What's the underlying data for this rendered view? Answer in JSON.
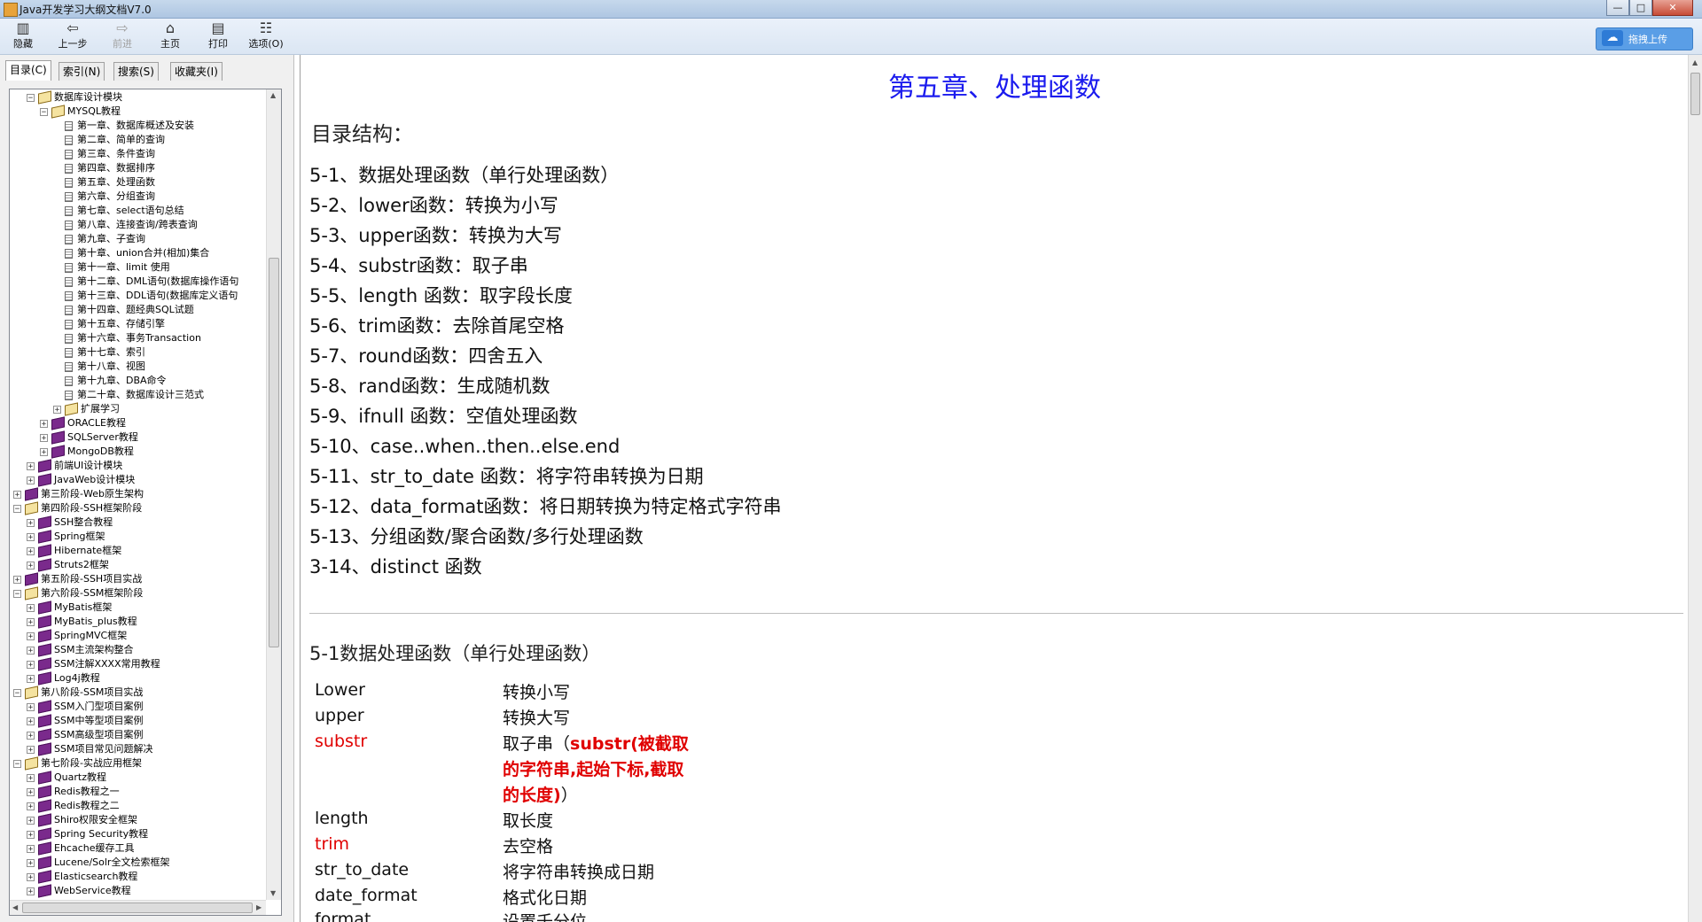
{
  "window": {
    "title": "Java开发学习大纲文档V7.0",
    "controls": [
      "—",
      "□",
      "✕"
    ]
  },
  "toolbar": {
    "buttons": [
      {
        "label": "隐藏",
        "icon": "hide-icon",
        "glyph": "▥"
      },
      {
        "label": "上一步",
        "icon": "back-arrow-icon",
        "glyph": "⇦"
      },
      {
        "label": "前进",
        "icon": "forward-arrow-icon",
        "glyph": "⇨"
      },
      {
        "label": "主页",
        "icon": "home-icon",
        "glyph": "⌂"
      },
      {
        "label": "打印",
        "icon": "printer-icon",
        "glyph": "▤"
      },
      {
        "label": "选项(O)",
        "icon": "options-icon",
        "glyph": "☷"
      }
    ],
    "upload_label": "拖拽上传"
  },
  "sidebar": {
    "tabs": [
      "目录(C)",
      "索引(N)",
      "搜索(S)",
      "收藏夹(I)"
    ],
    "tree": [
      {
        "level": 2,
        "exp": "−",
        "icon": "book-open",
        "label": "数据库设计模块"
      },
      {
        "level": 3,
        "exp": "−",
        "icon": "book-open",
        "label": "MYSQL教程"
      },
      {
        "level": 4,
        "icon": "page",
        "label": "第一章、数据库概述及安装"
      },
      {
        "level": 4,
        "icon": "page",
        "label": "第二章、简单的查询"
      },
      {
        "level": 4,
        "icon": "page",
        "label": "第三章、条件查询"
      },
      {
        "level": 4,
        "icon": "page",
        "label": "第四章、数据排序"
      },
      {
        "level": 4,
        "icon": "page",
        "label": "第五章、处理函数"
      },
      {
        "level": 4,
        "icon": "page",
        "label": "第六章、分组查询"
      },
      {
        "level": 4,
        "icon": "page",
        "label": "第七章、select语句总结"
      },
      {
        "level": 4,
        "icon": "page",
        "label": "第八章、连接查询/跨表查询"
      },
      {
        "level": 4,
        "icon": "page",
        "label": "第九章、子查询"
      },
      {
        "level": 4,
        "icon": "page",
        "label": "第十章、union合并(相加)集合"
      },
      {
        "level": 4,
        "icon": "page",
        "label": "第十一章、limit 使用"
      },
      {
        "level": 4,
        "icon": "page",
        "label": "第十二章、DML语句(数据库操作语句"
      },
      {
        "level": 4,
        "icon": "page",
        "label": "第十三章、DDL语句(数据库定义语句"
      },
      {
        "level": 4,
        "icon": "page",
        "label": "第十四章、题经典SQL试题"
      },
      {
        "level": 4,
        "icon": "page",
        "label": "第十五章、存储引擎"
      },
      {
        "level": 4,
        "icon": "page",
        "label": "第十六章、事务Transaction"
      },
      {
        "level": 4,
        "icon": "page",
        "label": "第十七章、索引"
      },
      {
        "level": 4,
        "icon": "page",
        "label": "第十八章、视图"
      },
      {
        "level": 4,
        "icon": "page",
        "label": "第十九章、DBA命令"
      },
      {
        "level": 4,
        "icon": "page",
        "label": "第二十章、数据库设计三范式"
      },
      {
        "level": 4,
        "exp": "+",
        "icon": "book-open",
        "label": "扩展学习"
      },
      {
        "level": 3,
        "exp": "+",
        "icon": "book",
        "label": "ORACLE教程"
      },
      {
        "level": 3,
        "exp": "+",
        "icon": "book",
        "label": "SQLServer教程"
      },
      {
        "level": 3,
        "exp": "+",
        "icon": "book",
        "label": "MongoDB教程"
      },
      {
        "level": 2,
        "exp": "+",
        "icon": "book",
        "label": "前端UI设计模块"
      },
      {
        "level": 2,
        "exp": "+",
        "icon": "book",
        "label": "JavaWeb设计模块"
      },
      {
        "level": 1,
        "exp": "+",
        "icon": "book",
        "label": "第三阶段-Web原生架构"
      },
      {
        "level": 1,
        "exp": "−",
        "icon": "book-open",
        "label": "第四阶段-SSH框架阶段"
      },
      {
        "level": 2,
        "exp": "+",
        "icon": "book",
        "label": "SSH整合教程"
      },
      {
        "level": 2,
        "exp": "+",
        "icon": "book",
        "label": "Spring框架"
      },
      {
        "level": 2,
        "exp": "+",
        "icon": "book",
        "label": "Hibernate框架"
      },
      {
        "level": 2,
        "exp": "+",
        "icon": "book",
        "label": "Struts2框架"
      },
      {
        "level": 1,
        "exp": "+",
        "icon": "book",
        "label": "第五阶段-SSH项目实战"
      },
      {
        "level": 1,
        "exp": "−",
        "icon": "book-open",
        "label": "第六阶段-SSM框架阶段"
      },
      {
        "level": 2,
        "exp": "+",
        "icon": "book",
        "label": "MyBatis框架"
      },
      {
        "level": 2,
        "exp": "+",
        "icon": "book",
        "label": "MyBatis_plus教程"
      },
      {
        "level": 2,
        "exp": "+",
        "icon": "book",
        "label": "SpringMVC框架"
      },
      {
        "level": 2,
        "exp": "+",
        "icon": "book",
        "label": "SSM主流架构整合"
      },
      {
        "level": 2,
        "exp": "+",
        "icon": "book",
        "label": "SSM注解XXXX常用教程"
      },
      {
        "level": 2,
        "exp": "+",
        "icon": "book",
        "label": "Log4j教程"
      },
      {
        "level": 1,
        "exp": "−",
        "icon": "book-open",
        "label": "第八阶段-SSM项目实战"
      },
      {
        "level": 2,
        "exp": "+",
        "icon": "book",
        "label": "SSM入门型项目案例"
      },
      {
        "level": 2,
        "exp": "+",
        "icon": "book",
        "label": "SSM中等型项目案例"
      },
      {
        "level": 2,
        "exp": "+",
        "icon": "book",
        "label": "SSM高级型项目案例"
      },
      {
        "level": 2,
        "exp": "+",
        "icon": "book",
        "label": "SSM项目常见问题解决"
      },
      {
        "level": 1,
        "exp": "−",
        "icon": "book-open",
        "label": "第七阶段-实战应用框架"
      },
      {
        "level": 2,
        "exp": "+",
        "icon": "book",
        "label": "Quartz教程"
      },
      {
        "level": 2,
        "exp": "+",
        "icon": "book",
        "label": "Redis教程之一"
      },
      {
        "level": 2,
        "exp": "+",
        "icon": "book",
        "label": "Redis教程之二"
      },
      {
        "level": 2,
        "exp": "+",
        "icon": "book",
        "label": "Shiro权限安全框架"
      },
      {
        "level": 2,
        "exp": "+",
        "icon": "book",
        "label": "Spring Security教程"
      },
      {
        "level": 2,
        "exp": "+",
        "icon": "book",
        "label": "Ehcache缓存工具"
      },
      {
        "level": 2,
        "exp": "+",
        "icon": "book",
        "label": "Lucene/Solr全文检索框架"
      },
      {
        "level": 2,
        "exp": "+",
        "icon": "book",
        "label": "Elasticsearch教程"
      },
      {
        "level": 2,
        "exp": "+",
        "icon": "book",
        "label": "WebService教程"
      }
    ]
  },
  "content": {
    "chapter_title": "第五章、处理函数",
    "toc_heading": "目录结构：",
    "toc_items": [
      "5-1、数据处理函数（单行处理函数）",
      "5-2、lower函数：转换为小写",
      "5-3、upper函数：转换为大写",
      "5-4、substr函数：取子串",
      "5-5、length 函数：取字段长度",
      "5-6、trim函数：去除首尾空格",
      "5-7、round函数：四舍五入",
      "5-8、rand函数：生成随机数",
      "5-9、ifnull 函数：空值处理函数",
      "5-10、case..when..then..else.end",
      "5-11、str_to_date 函数：将字符串转换为日期",
      "5-12、data_format函数：将日期转换为特定格式字符串",
      "5-13、分组函数/聚合函数/多行处理函数",
      "3-14、distinct 函数"
    ],
    "section_heading": "5-1数据处理函数（单行处理函数）",
    "functions": [
      {
        "name": "Lower",
        "desc": "转换小写"
      },
      {
        "name": "upper",
        "desc": "转换大写"
      },
      {
        "name": "substr",
        "desc_pre": "取子串（",
        "desc_bold": "substr(被截取的字符串,起始下标,截取的长度)",
        "desc_post": "）",
        "highlight": true
      },
      {
        "name": "length",
        "desc": "取长度"
      },
      {
        "name": "trim",
        "desc": "去空格",
        "highlight": true
      },
      {
        "name": "str_to_date",
        "desc": "将字符串转换成日期"
      },
      {
        "name": "date_format",
        "desc": "格式化日期"
      },
      {
        "name": "format",
        "desc": "设置千分位"
      }
    ]
  },
  "colors": {
    "title_blue": "#1a1aee",
    "highlight_red": "#e00000",
    "book_purple": "#7a2a8c"
  }
}
